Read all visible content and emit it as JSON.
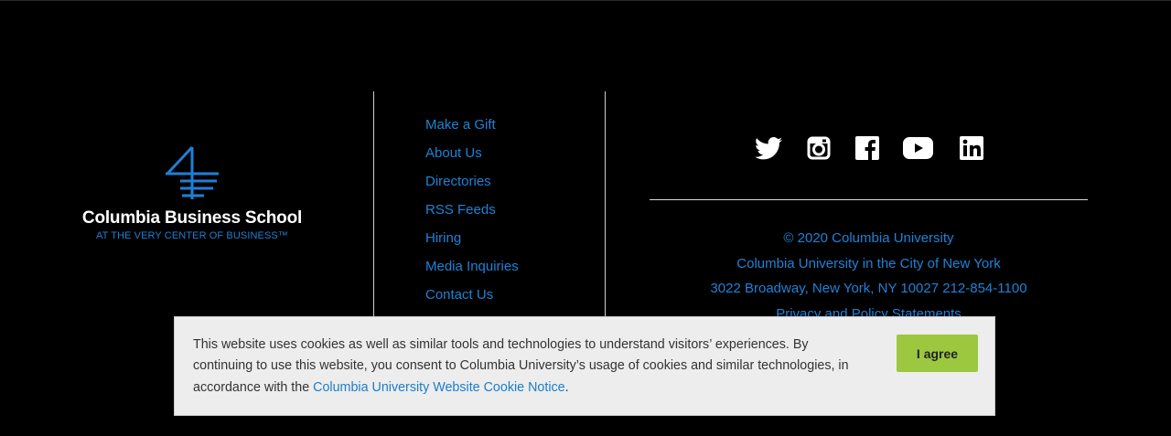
{
  "logo": {
    "name": "Columbia Business School",
    "tagline": "AT THE VERY CENTER OF BUSINESS™"
  },
  "footer_links": [
    {
      "label": "Make a Gift"
    },
    {
      "label": "About Us"
    },
    {
      "label": "Directories"
    },
    {
      "label": "RSS Feeds"
    },
    {
      "label": "Hiring"
    },
    {
      "label": "Media Inquiries"
    },
    {
      "label": "Contact Us"
    }
  ],
  "social_icons": [
    "twitter-icon",
    "instagram-icon",
    "facebook-icon",
    "youtube-icon",
    "linkedin-icon"
  ],
  "info": {
    "copyright": "© 2020 Columbia University",
    "city": "Columbia University in the City of New York",
    "address": "3022 Broadway, New York, NY 10027 212-854-1100",
    "privacy": "Privacy and Policy Statements"
  },
  "cookie": {
    "text": "This website uses cookies as well as similar tools and technologies to understand visitors’ experiences. By continuing to use this website, you consent to Columbia University’s usage of cookies and similar technologies, in accordance with the ",
    "link": "Columbia University Website Cookie Notice",
    "end": ".",
    "button": "I agree"
  },
  "colors": {
    "background": "#000000",
    "link_blue": "#1f82d6",
    "agree_green": "#9bc83f",
    "banner_bg": "#ededed"
  }
}
